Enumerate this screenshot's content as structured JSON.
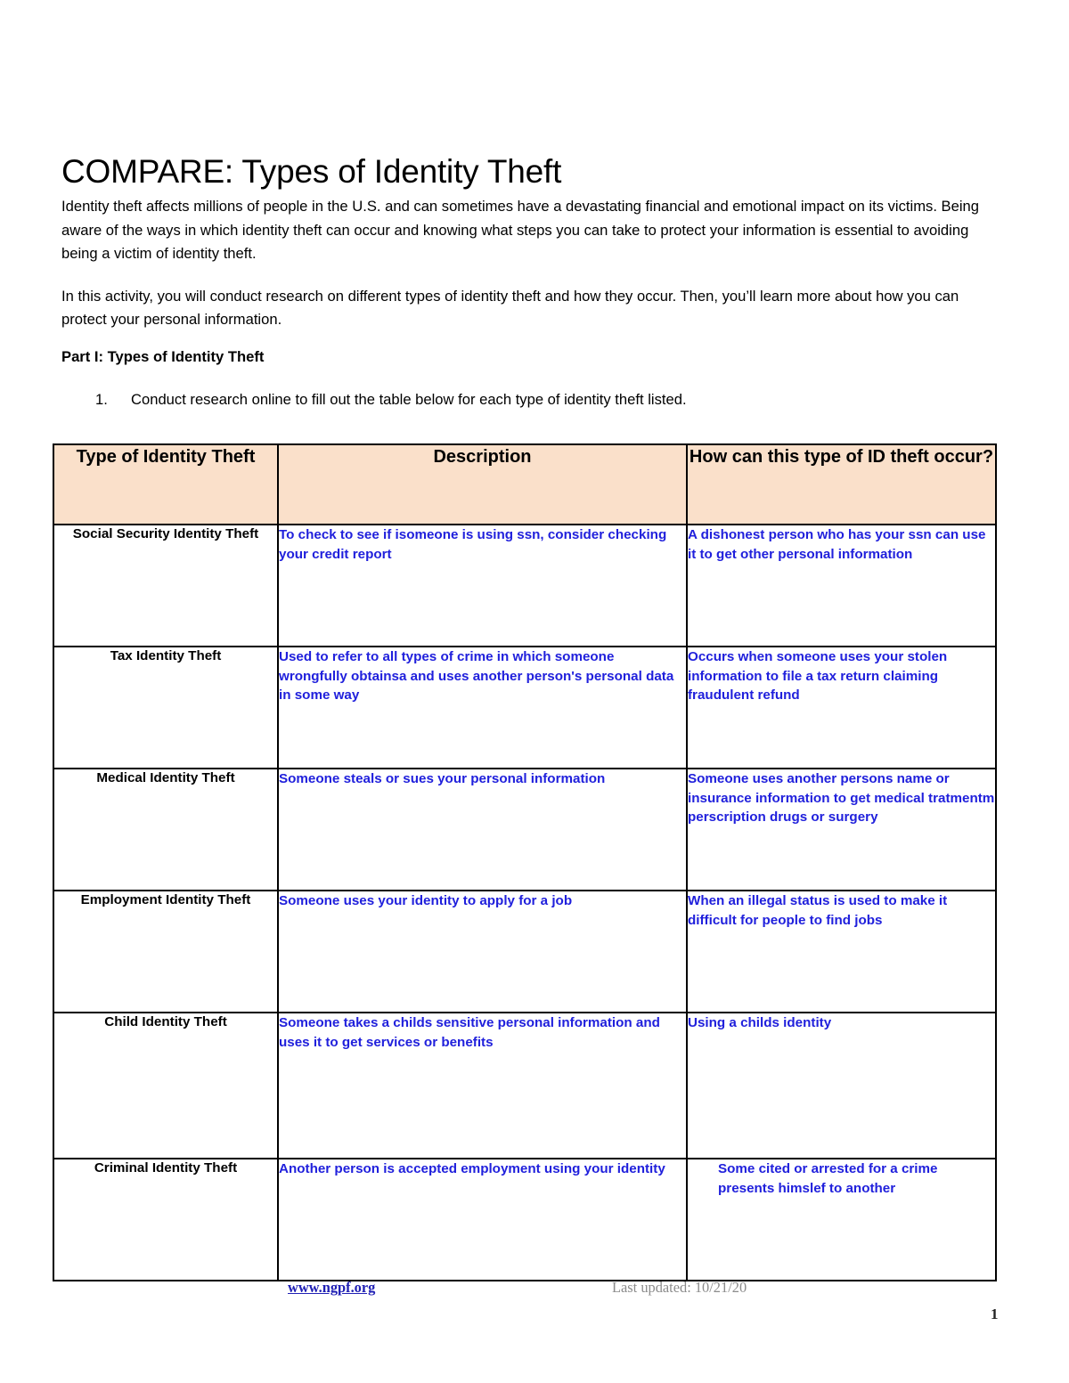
{
  "document": {
    "title": "COMPARE: Types of Identity Theft",
    "intro_paragraph_1": "Identity theft affects millions of people in the U.S. and can sometimes have a devastating financial and emotional impact on its victims. Being aware of the ways in which identity theft can occur and knowing what steps you can take to protect your information is essential to avoiding being a victim of identity theft.",
    "intro_paragraph_2": "In this activity, you will conduct research on different types of identity theft and how they occur. Then, you’ll learn more about how you can protect your personal information.",
    "section_heading": "Part I: Types of Identity Theft",
    "instruction_number": "1.",
    "instruction_text": "Conduct research online to fill out the table below for each type of identity theft listed."
  },
  "table": {
    "headers": {
      "col1": "Type of Identity Theft",
      "col2": "Description",
      "col3": "How can this type of ID theft occur?"
    },
    "rows": [
      {
        "type": "Social Security Identity Theft",
        "description": "To check to see if isomeone is using ssn, consider checking your credit report",
        "occurrence": "A dishonest person who has your ssn can use it to get other personal information"
      },
      {
        "type": "Tax Identity Theft",
        "description": "Used to refer to all types of crime in which someone wrongfully obtainsa and uses another person's personal data in some way",
        "occurrence": "Occurs when someone uses your stolen information to file a tax return claiming fraudulent refund"
      },
      {
        "type": "Medical Identity Theft",
        "description": "Someone steals or sues your personal information",
        "occurrence": "Someone uses another persons name or insurance information to get medical tratmentm perscription drugs or surgery"
      },
      {
        "type": "Employment Identity Theft",
        "description": "Someone uses your identity to apply for a job",
        "occurrence": "When an illegal status is used to make it difficult for people to find jobs"
      },
      {
        "type": "Child Identity Theft",
        "description": "Someone takes a childs sensitive personal information and uses it to get services or benefits",
        "occurrence": "Using a childs identity"
      },
      {
        "type": "Criminal Identity Theft",
        "description": "Another person is accepted employment using your identity",
        "occurrence": "Some cited or arrested for a crime presents himslef to another"
      }
    ]
  },
  "footer": {
    "link_text": "www.ngpf.org",
    "last_updated": "Last updated: 10/21/20",
    "page_number": "1"
  },
  "colors": {
    "header_fill": "#FAE0CA",
    "answer_text": "#2020DC",
    "link": "#2020B4",
    "muted": "#8C8C8C"
  }
}
